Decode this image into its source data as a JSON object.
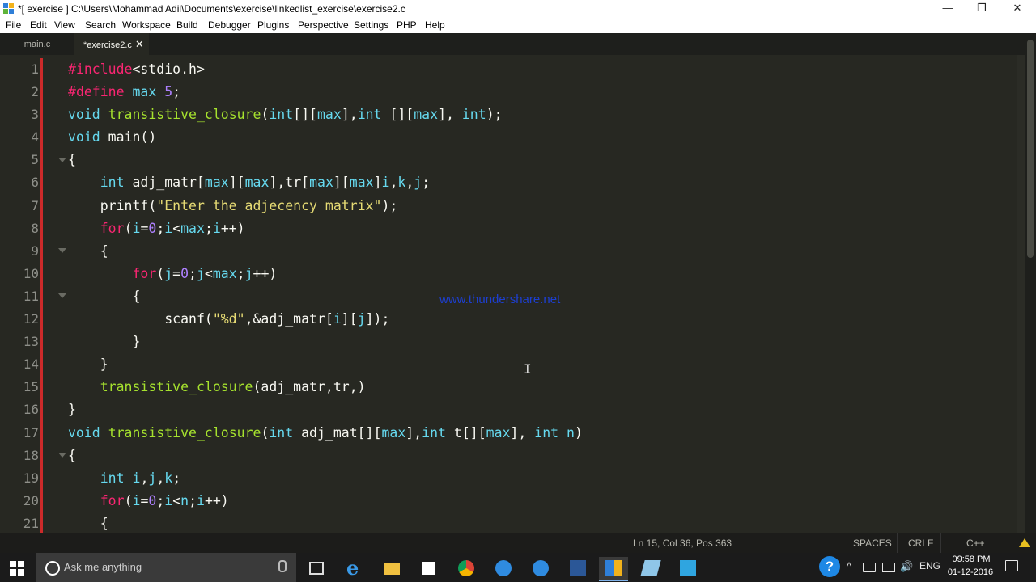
{
  "window": {
    "title": "*[ exercise ] C:\\Users\\Mohammad Adil\\Documents\\exercise\\linkedlist_exercise\\exercise2.c",
    "minimize": "—",
    "restore": "❐",
    "close": "✕"
  },
  "menu": [
    "File",
    "Edit",
    "View",
    "Search",
    "Workspace",
    "Build",
    "Debugger",
    "Plugins",
    "Perspective",
    "Settings",
    "PHP",
    "Help"
  ],
  "tabs": [
    {
      "label": "main.c"
    },
    {
      "label": "*exercise2.c",
      "close": "✕"
    }
  ],
  "gutter": {
    "line_numbers": [
      "1",
      "2",
      "3",
      "4",
      "5",
      "6",
      "7",
      "8",
      "9",
      "10",
      "11",
      "12",
      "13",
      "14",
      "15",
      "16",
      "17",
      "18",
      "19",
      "20",
      "21"
    ]
  },
  "code": {
    "lines": [
      "#include<stdio.h>",
      "#define max 5;",
      "void transistive_closure(int[][max],int [][max], int);",
      "void main()",
      "{",
      "    int adj_matr[max][max],tr[max][max]i,k,j;",
      "    printf(\"Enter the adjecency matrix\");",
      "    for(i=0;i<max;i++)",
      "    {",
      "        for(j=0;j<max;j++)",
      "        {",
      "            scanf(\"%d\",&adj_matr[i][j]);",
      "        }",
      "    }",
      "    transistive_closure(adj_matr,tr,)",
      "}",
      "void transistive_closure(int adj_mat[][max],int t[][max], int n)",
      "{",
      "    int i,j,k;",
      "    for(i=0;i<n;i++)",
      "    {"
    ]
  },
  "watermark": "www.thundershare.net",
  "cursor": "I",
  "statusbar": {
    "position": "Ln 15, Col 36, Pos 363",
    "indent": "SPACES",
    "line_ending": "CRLF",
    "language": "C++"
  },
  "taskbar": {
    "search_placeholder": "Ask me anything",
    "help": "?",
    "tray_arrow": "^",
    "volume": "🔊",
    "language": "ENG",
    "time": "09:58 PM",
    "date": "01-12-2016"
  },
  "colors": {
    "editor_bg": "#272822",
    "keyword": "#f92672",
    "type": "#66d9ef",
    "function": "#a6e22e",
    "number": "#ae81ff",
    "string": "#e6db74",
    "watermark": "#1d3fd1",
    "modified_marker": "#cc2a2a"
  }
}
